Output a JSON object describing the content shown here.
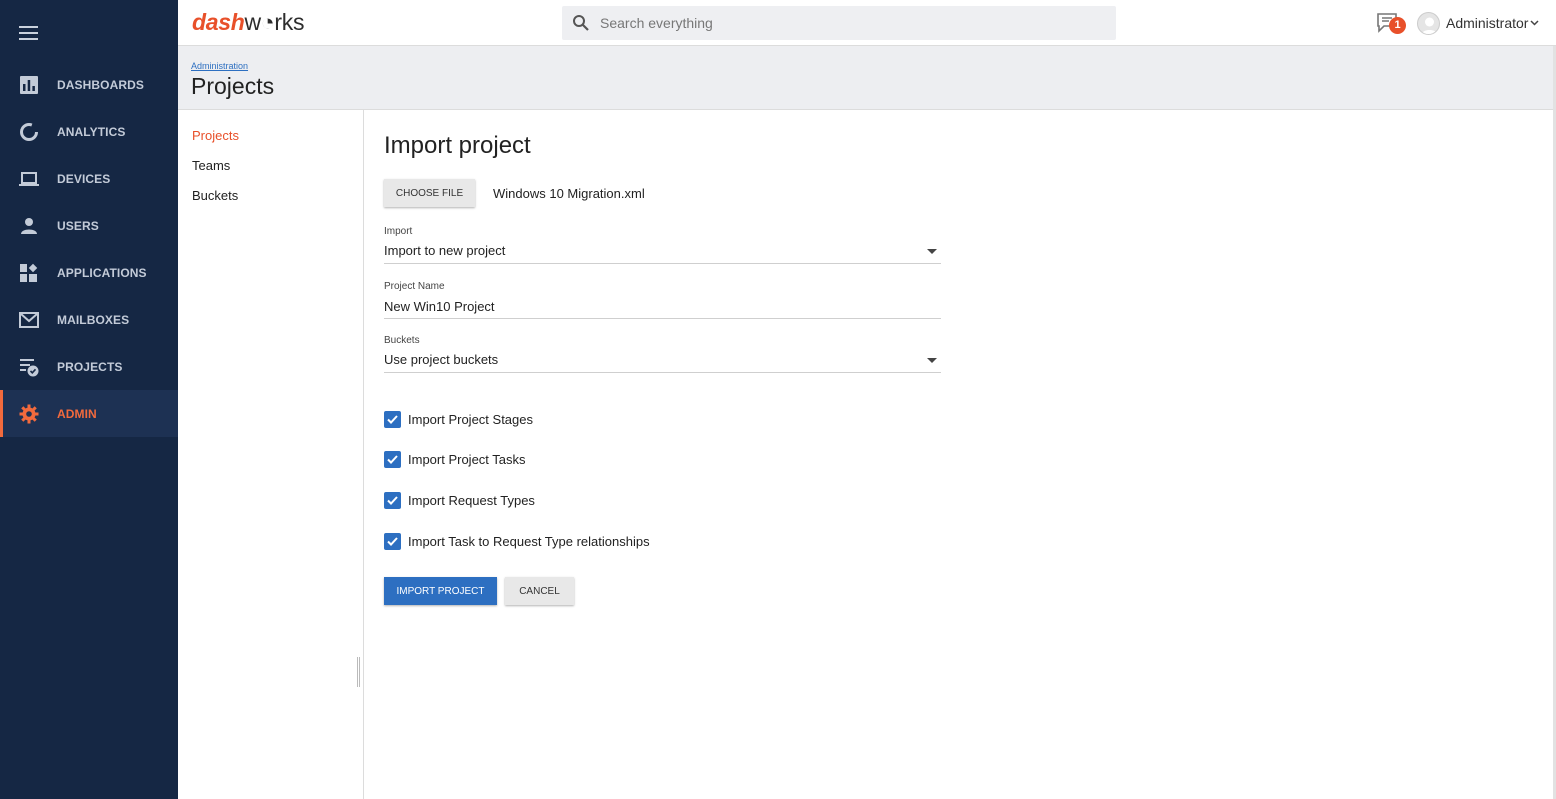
{
  "app": {
    "logo_part1": "dash",
    "logo_part2": "w",
    "logo_part3": "rks",
    "accent_color": "#e8502a",
    "nav_bg_color": "#152744",
    "primary_color": "#2d6fc1"
  },
  "sidenav": {
    "items": [
      {
        "label": "DASHBOARDS",
        "icon": "bar-chart-icon"
      },
      {
        "label": "ANALYTICS",
        "icon": "donut-chart-icon"
      },
      {
        "label": "DEVICES",
        "icon": "laptop-icon"
      },
      {
        "label": "USERS",
        "icon": "person-icon"
      },
      {
        "label": "APPLICATIONS",
        "icon": "widgets-icon"
      },
      {
        "label": "MAILBOXES",
        "icon": "mail-icon"
      },
      {
        "label": "PROJECTS",
        "icon": "checklist-icon"
      },
      {
        "label": "ADMIN",
        "icon": "gear-icon",
        "active": true
      }
    ]
  },
  "topbar": {
    "search_placeholder": "Search everything",
    "notification_count": "1",
    "user_name": "Administrator"
  },
  "header": {
    "breadcrumb": "Administration",
    "title": "Projects"
  },
  "subnav": {
    "items": [
      "Projects",
      "Teams",
      "Buckets"
    ],
    "active": "Projects"
  },
  "form": {
    "title": "Import project",
    "choose_file_label": "CHOOSE FILE",
    "file_name": "Windows 10 Migration.xml",
    "import_label": "Import",
    "import_value": "Import to new project",
    "project_name_label": "Project Name",
    "project_name_value": "New Win10 Project",
    "buckets_label": "Buckets",
    "buckets_value": "Use project buckets",
    "checkboxes": [
      {
        "label": "Import Project Stages",
        "checked": true
      },
      {
        "label": "Import Project Tasks",
        "checked": true
      },
      {
        "label": "Import Request Types",
        "checked": true
      },
      {
        "label": "Import Task to Request Type relationships",
        "checked": true
      }
    ],
    "submit_label": "IMPORT PROJECT",
    "cancel_label": "CANCEL"
  }
}
